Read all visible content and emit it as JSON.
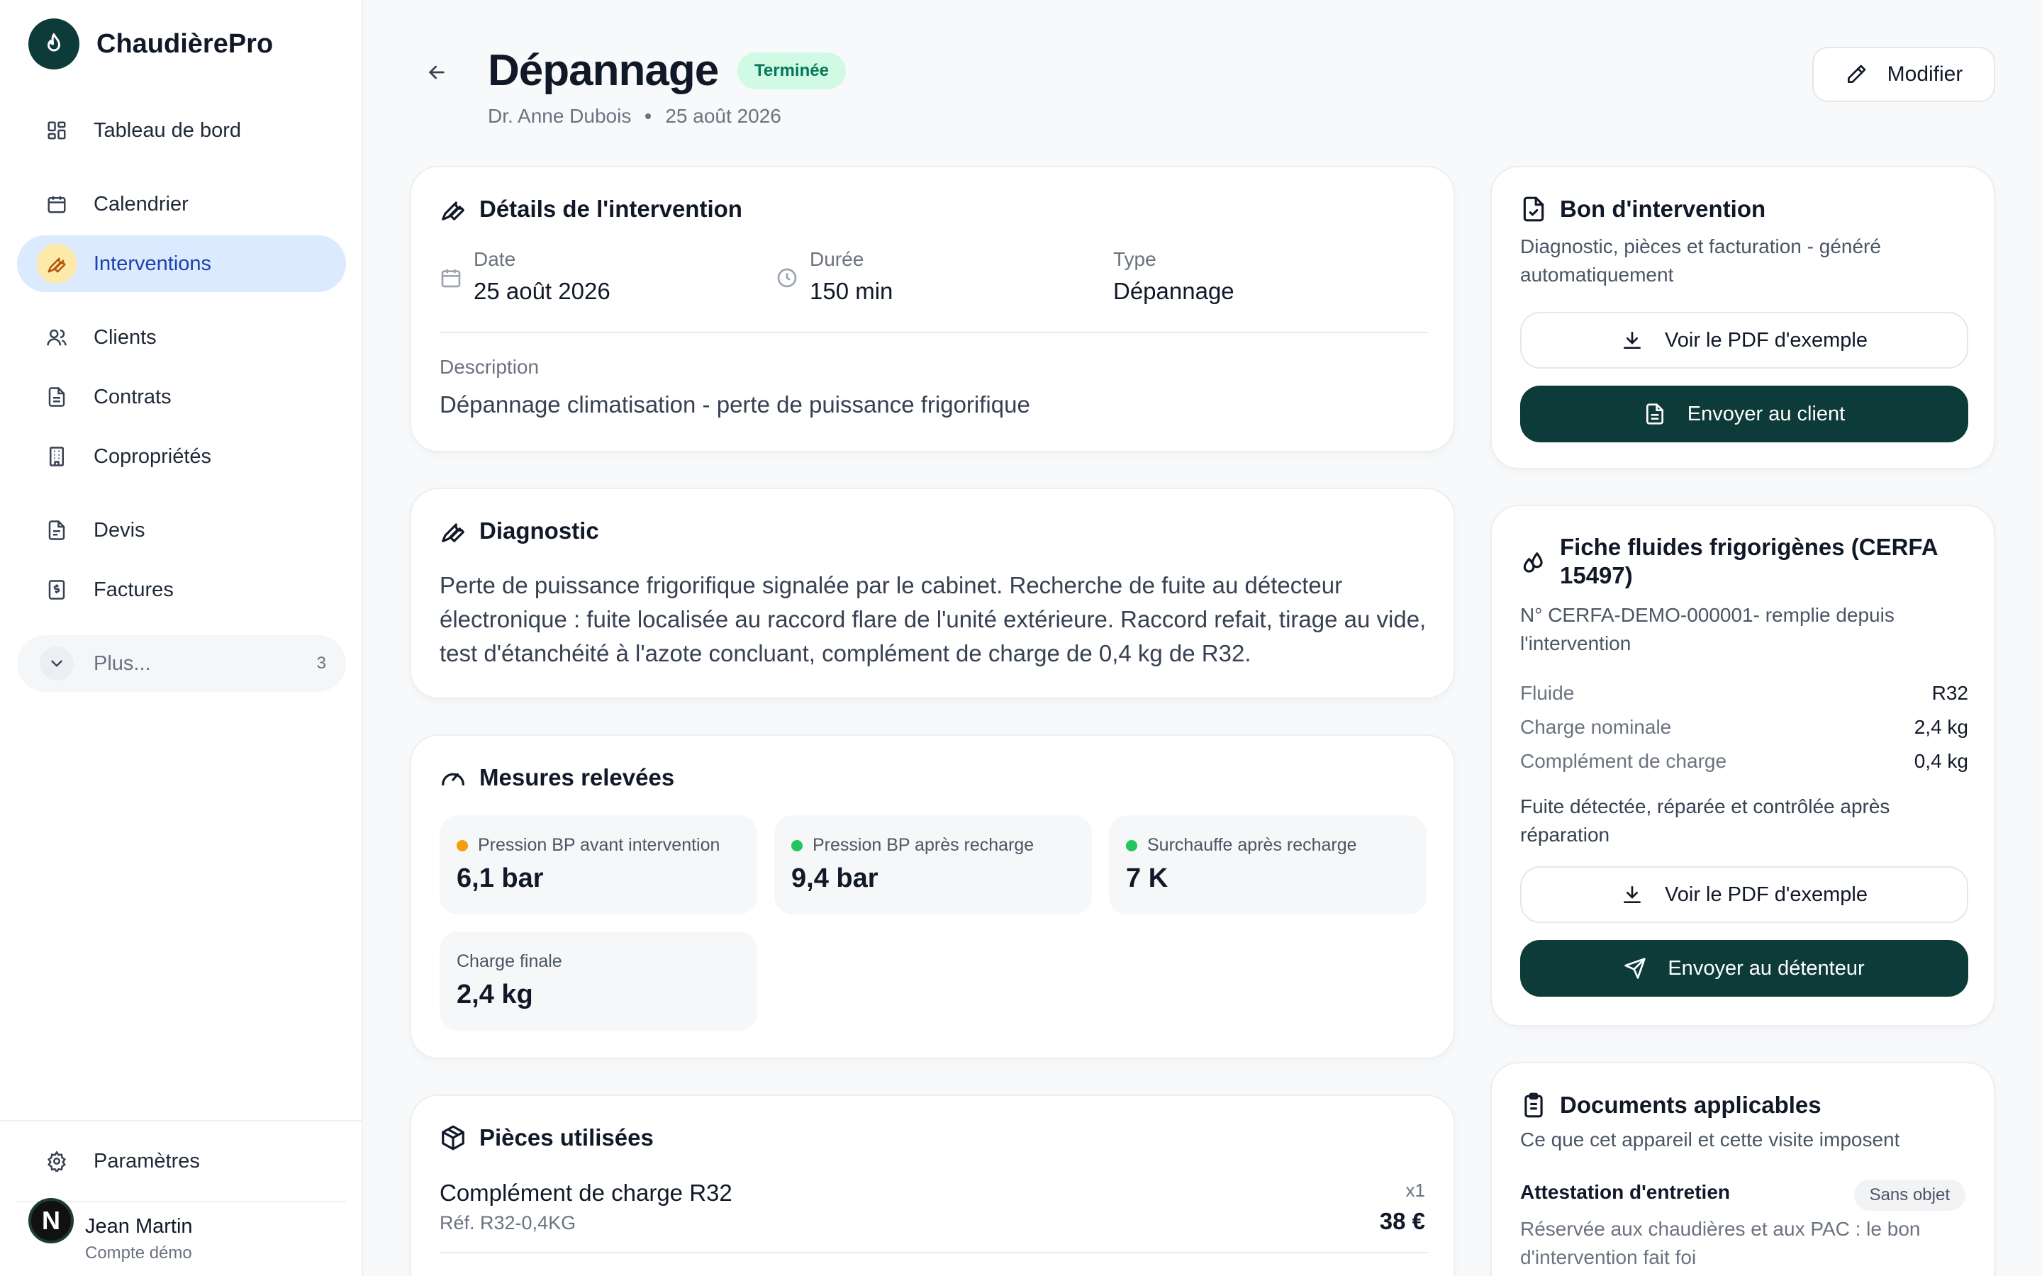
{
  "app": {
    "name": "ChaudièrePro"
  },
  "sidebar": {
    "items": [
      {
        "label": "Tableau de bord",
        "icon": "dashboard-icon"
      },
      {
        "label": "Calendrier",
        "icon": "calendar-icon"
      },
      {
        "label": "Interventions",
        "icon": "wrench-icon",
        "active": true
      },
      {
        "label": "Clients",
        "icon": "users-icon"
      },
      {
        "label": "Contrats",
        "icon": "file-icon"
      },
      {
        "label": "Copropriétés",
        "icon": "building-icon"
      },
      {
        "label": "Devis",
        "icon": "file-text-icon"
      },
      {
        "label": "Factures",
        "icon": "invoice-icon"
      }
    ],
    "more": {
      "label": "Plus...",
      "count": "3"
    },
    "settings_label": "Paramètres",
    "user": {
      "initial": "N",
      "name": "Jean Martin",
      "subtitle": "Compte démo"
    }
  },
  "header": {
    "title": "Dépannage",
    "status": "Terminée",
    "technician": "Dr. Anne Dubois",
    "date": "25 août 2026",
    "edit_label": "Modifier"
  },
  "details": {
    "title": "Détails de l'intervention",
    "date_label": "Date",
    "date_value": "25 août 2026",
    "duration_label": "Durée",
    "duration_value": "150 min",
    "type_label": "Type",
    "type_value": "Dépannage",
    "description_label": "Description",
    "description_value": "Dépannage climatisation - perte de puissance frigorifique"
  },
  "diagnostic": {
    "title": "Diagnostic",
    "text": "Perte de puissance frigorifique signalée par le cabinet. Recherche de fuite au détecteur électronique : fuite localisée au raccord flare de l'unité extérieure. Raccord refait, tirage au vide, test d'étanchéité à l'azote concluant, complément de charge de 0,4 kg de R32."
  },
  "measures": {
    "title": "Mesures relevées",
    "items": [
      {
        "label": "Pression BP avant intervention",
        "value": "6,1 bar",
        "status_color": "#f59e0b"
      },
      {
        "label": "Pression BP après recharge",
        "value": "9,4 bar",
        "status_color": "#22c55e"
      },
      {
        "label": "Surchauffe après recharge",
        "value": "7 K",
        "status_color": "#22c55e"
      },
      {
        "label": "Charge finale",
        "value": "2,4 kg"
      }
    ]
  },
  "parts": {
    "title": "Pièces utilisées",
    "items": [
      {
        "name": "Complément de charge R32",
        "ref": "Réf. R32-0,4KG",
        "qty": "x1",
        "price": "38 €"
      }
    ]
  },
  "bon": {
    "title": "Bon d'intervention",
    "desc": "Diagnostic, pièces et facturation - généré automatiquement",
    "pdf_label": "Voir le PDF d'exemple",
    "send_label": "Envoyer au client"
  },
  "cerfa": {
    "title": "Fiche fluides frigorigènes (CERFA 15497)",
    "desc": "N° CERFA-DEMO-000001- remplie depuis l'intervention",
    "rows": [
      {
        "k": "Fluide",
        "v": "R32"
      },
      {
        "k": "Charge nominale",
        "v": "2,4 kg"
      },
      {
        "k": "Complément de charge",
        "v": "0,4 kg"
      }
    ],
    "note": "Fuite détectée, réparée et contrôlée après réparation",
    "pdf_label": "Voir le PDF d'exemple",
    "send_label": "Envoyer au détenteur"
  },
  "documents": {
    "title": "Documents applicables",
    "desc": "Ce que cet appareil et cette visite imposent",
    "items": [
      {
        "name": "Attestation d'entretien",
        "badge": "Sans objet",
        "text": "Réservée aux chaudières et aux PAC : le bon d'intervention fait foi"
      }
    ]
  },
  "colors": {
    "brand": "#0d3b39",
    "active_bg": "#dbeafe",
    "active_text": "#1e40af",
    "success_bg": "#d1fae5",
    "success_text": "#047857"
  }
}
